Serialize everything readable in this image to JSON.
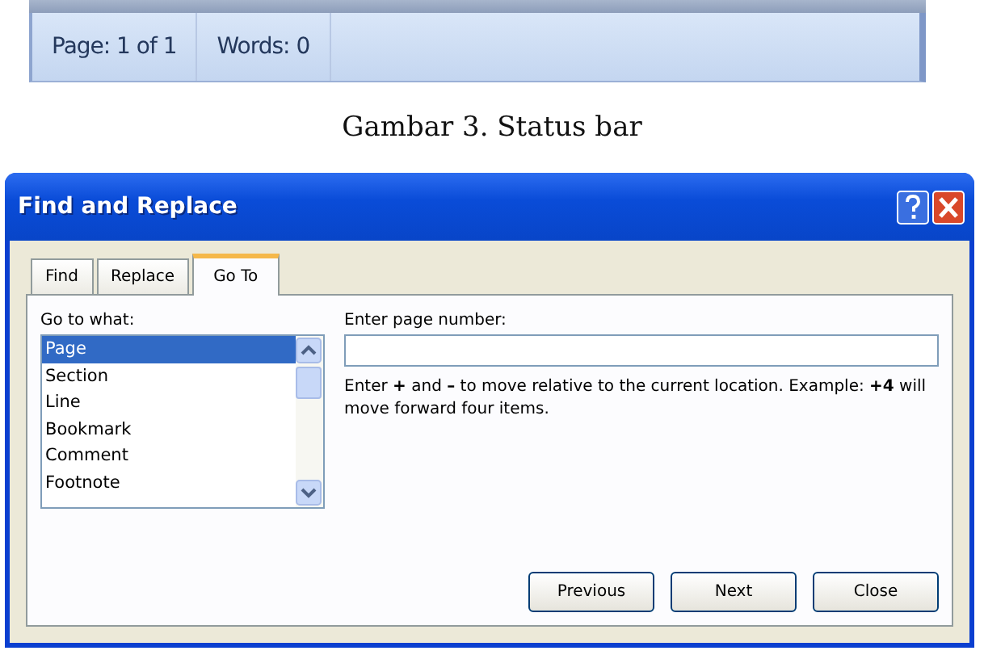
{
  "status_bar": {
    "items": [
      "Page: 1 of 1",
      "Words: 0"
    ]
  },
  "caption": "Gambar 3. Status bar",
  "dialog": {
    "title": "Find and Replace",
    "tabs": [
      {
        "label": "Find",
        "selected": false
      },
      {
        "label": "Replace",
        "selected": false
      },
      {
        "label": "Go To",
        "selected": true
      }
    ],
    "goto_label": "Go to what:",
    "goto_items": [
      {
        "label": "Page",
        "selected": true
      },
      {
        "label": "Section",
        "selected": false
      },
      {
        "label": "Line",
        "selected": false
      },
      {
        "label": "Bookmark",
        "selected": false
      },
      {
        "label": "Comment",
        "selected": false
      },
      {
        "label": "Footnote",
        "selected": false
      }
    ],
    "field_label": "Enter page number:",
    "hint": "Enter **+** and **–** to move relative to the current location. Example: **+4** will move forward four items.",
    "buttons": [
      "Previous",
      "Next",
      "Close"
    ]
  }
}
